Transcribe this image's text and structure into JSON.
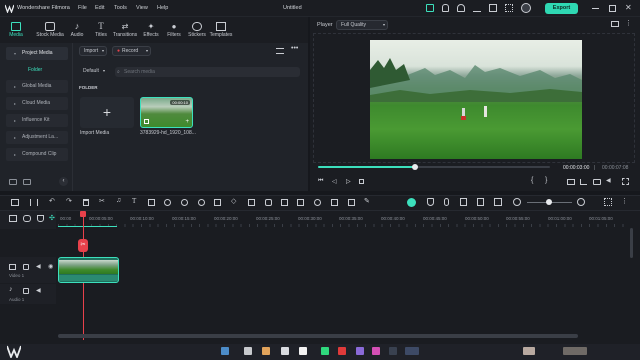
{
  "titlebar": {
    "app_name": "Wondershare Filmora",
    "menu": [
      "File",
      "Edit",
      "Tools",
      "View",
      "Help"
    ],
    "project": "Untitled",
    "export_label": "Export"
  },
  "tabs": [
    {
      "label": "Media",
      "icon": "media-icon",
      "active": true
    },
    {
      "label": "Stock Media",
      "icon": "stock-media-icon"
    },
    {
      "label": "Audio",
      "icon": "audio-icon"
    },
    {
      "label": "Titles",
      "icon": "titles-icon"
    },
    {
      "label": "Transitions",
      "icon": "transitions-icon"
    },
    {
      "label": "Effects",
      "icon": "effects-icon"
    },
    {
      "label": "Filters",
      "icon": "filters-icon"
    },
    {
      "label": "Stickers",
      "icon": "stickers-icon"
    },
    {
      "label": "Templates",
      "icon": "templates-icon"
    }
  ],
  "media": {
    "sidebar": [
      {
        "label": "Project Media",
        "active": true
      },
      {
        "label": "Global Media"
      },
      {
        "label": "Cloud Media"
      },
      {
        "label": "Influence Kit"
      },
      {
        "label": "Adjustment La..."
      },
      {
        "label": "Compound Clip"
      }
    ],
    "folder_label": "Folder",
    "import_label": "Import",
    "record_label": "Record",
    "default_label": "Default",
    "search_placeholder": "Search media",
    "section_label": "FOLDER",
    "import_media_label": "Import Media",
    "clip_name": "3783929-hd_1920_108...",
    "clip_duration": "00:00:10"
  },
  "player": {
    "label": "Player",
    "quality": "Full Quality",
    "current_time": "00:00:03:00",
    "total_time": "00:00:07:08",
    "progress": 0.42
  },
  "timeline": {
    "ruler": [
      "00:00",
      "00:00:05:00",
      "00:00:10:00",
      "00:00:15:00",
      "00:00:20:00",
      "00:00:25:00",
      "00:00:30:00",
      "00:00:35:00",
      "00:00:40:00",
      "00:00:45:00",
      "00:00:50:00",
      "00:00:55:00",
      "00:01:00:00",
      "00:01:05:00"
    ],
    "video_track": "Video 1",
    "audio_track": "Audio 1"
  },
  "colors": {
    "accent": "#3ce0bd",
    "playhead": "#e8414b"
  }
}
